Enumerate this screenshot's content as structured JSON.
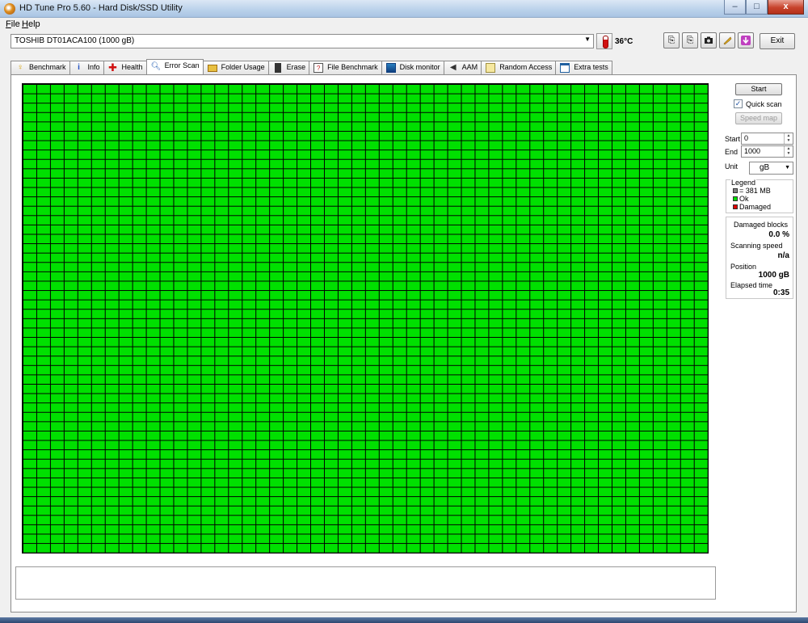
{
  "window": {
    "title": "HD Tune Pro 5.60 - Hard Disk/SSD Utility"
  },
  "window_controls": {
    "minimize": "–",
    "maximize": "□",
    "close": "x"
  },
  "menu": [
    {
      "mnemonic": "F",
      "rest": "ile"
    },
    {
      "mnemonic": "H",
      "rest": "elp"
    }
  ],
  "toolbar": {
    "drive": "TOSHIB DT01ACA100 (1000 gB)",
    "temperature": "36°C",
    "exit_label": "Exit",
    "tool_icons": [
      "copy-text-icon",
      "copy-info-icon",
      "camera-icon",
      "options-icon",
      "save-icon"
    ]
  },
  "tabs": [
    {
      "label": "Benchmark",
      "icon": "benchmark-icon"
    },
    {
      "label": "Info",
      "icon": "info-icon"
    },
    {
      "label": "Health",
      "icon": "health-icon"
    },
    {
      "label": "Error Scan",
      "icon": "error-scan-icon",
      "active": true
    },
    {
      "label": "Folder Usage",
      "icon": "folder-icon"
    },
    {
      "label": "Erase",
      "icon": "erase-icon"
    },
    {
      "label": "File Benchmark",
      "icon": "file-benchmark-icon"
    },
    {
      "label": "Disk monitor",
      "icon": "disk-monitor-icon"
    },
    {
      "label": "AAM",
      "icon": "speaker-icon"
    },
    {
      "label": "Random Access",
      "icon": "random-access-icon"
    },
    {
      "label": "Extra tests",
      "icon": "extra-tests-icon"
    }
  ],
  "scan": {
    "grid_columns": 50,
    "grid_rows": 50,
    "block_state": "Ok",
    "ok_color": "#00e000",
    "damaged_color": "#e00000",
    "block_size_color": "#808080"
  },
  "controls": {
    "start_button": "Start",
    "quick_scan_label": "Quick scan",
    "quick_scan_checked": true,
    "speed_map_button": "Speed map",
    "start_label": "Start",
    "start_value": "0",
    "end_label": "End",
    "end_value": "1000",
    "unit_label": "Unit",
    "unit_value": "gB"
  },
  "legend": {
    "title": "Legend",
    "block_size": "= 381 MB",
    "ok": "Ok",
    "damaged": "Damaged"
  },
  "stats": {
    "damaged_blocks_label": "Damaged blocks",
    "damaged_blocks_value": "0.0 %",
    "scanning_speed_label": "Scanning speed",
    "scanning_speed_value": "n/a",
    "position_label": "Position",
    "position_value": "1000 gB",
    "elapsed_label": "Elapsed time",
    "elapsed_value": "0:35"
  }
}
